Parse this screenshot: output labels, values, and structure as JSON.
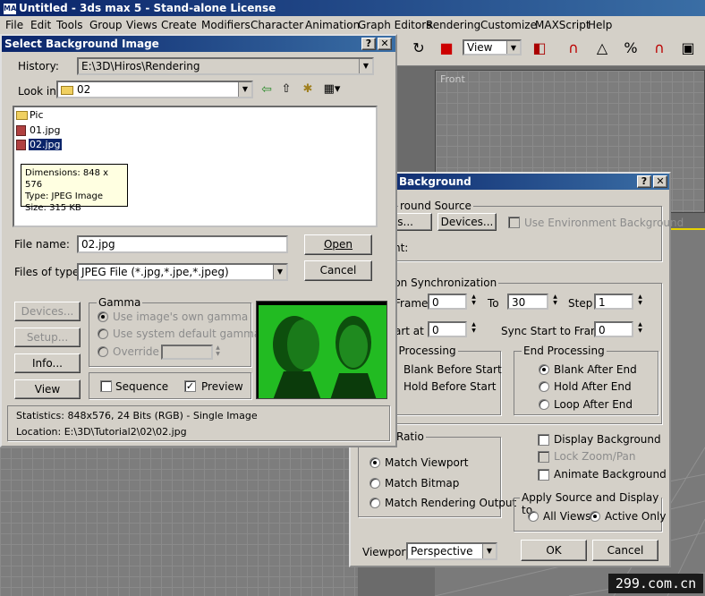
{
  "app": {
    "title": "Untitled - 3ds max 5 - Stand-alone License",
    "menu": [
      "File",
      "Edit",
      "Tools",
      "Group",
      "Views",
      "Create",
      "Modifiers",
      "Character",
      "Animation",
      "Graph Editors",
      "Rendering",
      "Customize",
      "MAXScript",
      "Help"
    ],
    "view_combo": "View",
    "viewport_front_label": "Front"
  },
  "select_dialog": {
    "title": "Select Background Image",
    "help_btn": "?",
    "close_btn": "✕",
    "history_label": "History:",
    "history_value": "E:\\3D\\Hiros\\Rendering",
    "lookin_label": "Look in:",
    "lookin_value": "02",
    "files": [
      {
        "name": "Pic",
        "type": "folder"
      },
      {
        "name": "01.jpg",
        "type": "image"
      },
      {
        "name": "02.jpg",
        "type": "image",
        "selected": true
      }
    ],
    "tooltip": {
      "line1": "Dimensions: 848 x 576",
      "line2": "Type: JPEG Image",
      "line3": "Size: 315 KB"
    },
    "filename_label": "File name:",
    "filename_value": "02.jpg",
    "filetype_label": "Files of type:",
    "filetype_value": "JPEG File (*.jpg,*.jpe,*.jpeg)",
    "open_btn": "Open",
    "cancel_btn": "Cancel",
    "devices_btn": "Devices...",
    "setup_btn": "Setup...",
    "info_btn": "Info...",
    "view_btn": "View",
    "gamma": {
      "title": "Gamma",
      "opt1": "Use image's own gamma",
      "opt2": "Use system default gamma",
      "opt3": "Override"
    },
    "sequence_label": "Sequence",
    "preview_label": "Preview",
    "preview_checked": true,
    "sequence_checked": false,
    "statistics": "Statistics:  848x576, 24 Bits (RGB) - Single Image",
    "location": "Location:  E:\\3D\\Tutorial2\\02\\02.jpg"
  },
  "bg_dialog": {
    "title": "Background",
    "help_btn": "?",
    "close_btn": "✕",
    "source_title": "round Source",
    "files_btn": "es...",
    "devices_btn": "Devices...",
    "use_env_bg": "Use Environment Background",
    "current_label": "nt:",
    "anim_sync_title": "ion Synchronization",
    "frame_label": "Frame",
    "frame_value": "0",
    "to_label": "To",
    "to_value": "30",
    "step_label": "Step",
    "step_value": "1",
    "start_at_label": "art at",
    "start_at_value": "0",
    "sync_start_label": "Sync Start to Frame",
    "sync_start_value": "0",
    "start_proc_title": "t Processing",
    "blank_before_start": "Blank Before Start",
    "hold_before_start": "Hold Before Start",
    "end_proc_title": "End Processing",
    "blank_after_end": "Blank After End",
    "hold_after_end": "Hold After End",
    "loop_after_end": "Loop After End",
    "aspect_title": "Ratio",
    "match_viewport": "Match Viewport",
    "match_bitmap": "Match Bitmap",
    "match_rendering": "Match Rendering Output",
    "display_bg": "Display Background",
    "lock_zoom": "Lock Zoom/Pan",
    "animate_bg": "Animate Background",
    "apply_title": "Apply Source and Display to",
    "all_views": "All Views",
    "active_only": "Active Only",
    "viewport_label": "Viewport:",
    "viewport_value": "Perspective",
    "ok_btn": "OK",
    "cancel_btn": "Cancel"
  },
  "watermark": "299.com.cn",
  "colors": {
    "titlebar": "#0a246a",
    "dialog": "#d4d0c8",
    "viewport": "#7d7d7d",
    "preview_green": "#22bb22"
  }
}
